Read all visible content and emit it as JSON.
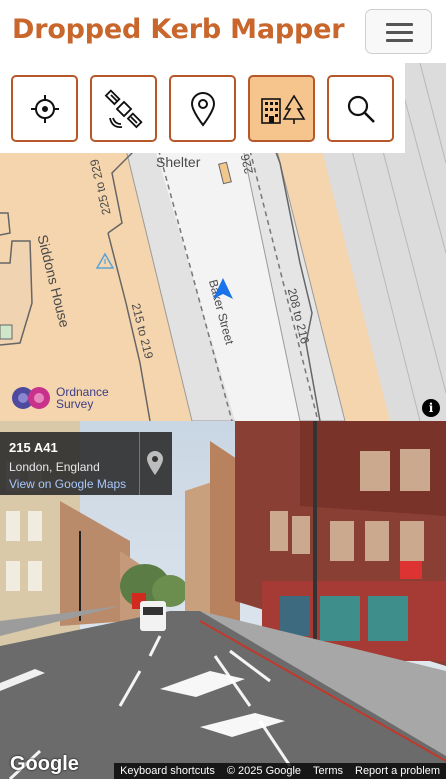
{
  "app": {
    "title": "Dropped Kerb Mapper",
    "brand_color": "#c8662c"
  },
  "header": {
    "menu_icon": "hamburger-icon"
  },
  "toolbar": {
    "tools": [
      {
        "icon": "locate-crosshair-icon",
        "active": false
      },
      {
        "icon": "satellite-icon",
        "active": false
      },
      {
        "icon": "map-pin-icon",
        "active": false
      },
      {
        "icon": "buildings-trees-icon",
        "active": true
      },
      {
        "icon": "search-icon",
        "active": false
      }
    ],
    "active_color": "#f6c58d"
  },
  "map": {
    "labels": {
      "shelter": "Shelter",
      "siddons_house": "Siddons House",
      "street": "Baker Street",
      "addr_225_229": "225 to 229",
      "addr_226": "226",
      "addr_208_216": "208 to 216",
      "addr_215_219": "215 to 219"
    },
    "attribution_logo": {
      "line1": "Ordnance",
      "line2": "Survey"
    },
    "info_icon": "info-icon",
    "direction_icon": "navigation-arrow-icon"
  },
  "streetview": {
    "address": {
      "title": "215 A41",
      "subtitle": "London, England",
      "link": "View on Google Maps"
    },
    "pin_icon": "pin-icon",
    "logo": "Google",
    "attribution": [
      "Keyboard shortcuts",
      "© 2025 Google",
      "Terms",
      "Report a problem"
    ]
  }
}
